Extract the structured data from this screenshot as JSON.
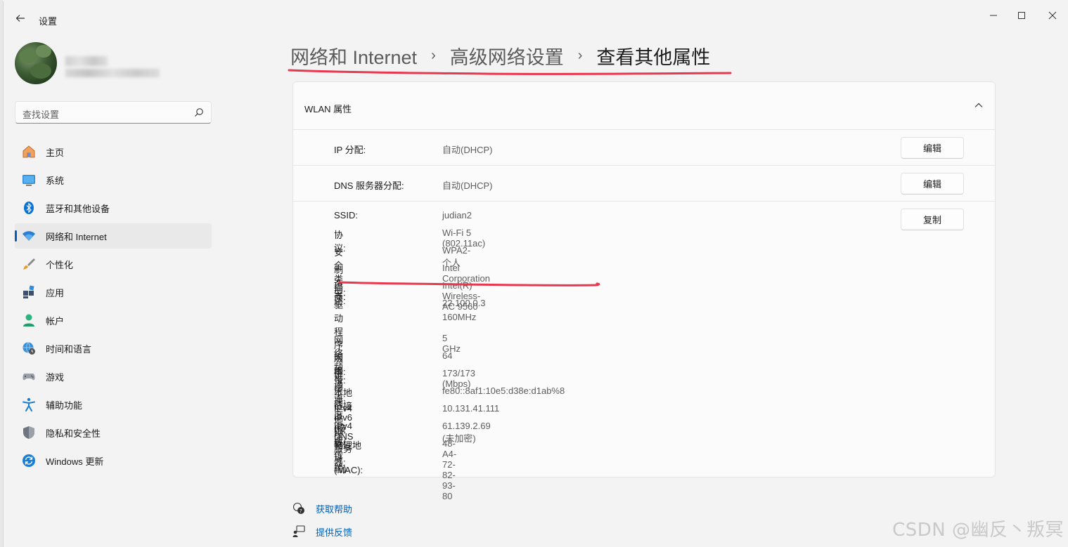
{
  "window": {
    "app_title": "设置",
    "controls": {
      "minimize": "—",
      "close": "✕"
    }
  },
  "search": {
    "placeholder": "查找设置"
  },
  "sidebar": {
    "items": [
      {
        "label": "主页",
        "icon": "home-icon"
      },
      {
        "label": "系统",
        "icon": "monitor-icon"
      },
      {
        "label": "蓝牙和其他设备",
        "icon": "bluetooth-icon"
      },
      {
        "label": "网络和 Internet",
        "icon": "wifi-icon",
        "active": true
      },
      {
        "label": "个性化",
        "icon": "brush-icon"
      },
      {
        "label": "应用",
        "icon": "apps-icon"
      },
      {
        "label": "帐户",
        "icon": "person-icon"
      },
      {
        "label": "时间和语言",
        "icon": "globe-clock-icon"
      },
      {
        "label": "游戏",
        "icon": "gamepad-icon"
      },
      {
        "label": "辅助功能",
        "icon": "accessibility-icon"
      },
      {
        "label": "隐私和安全性",
        "icon": "shield-icon"
      },
      {
        "label": "Windows 更新",
        "icon": "update-icon"
      }
    ]
  },
  "breadcrumb": {
    "items": [
      "网络和 Internet",
      "高级网络设置",
      "查看其他属性"
    ],
    "separator": "›"
  },
  "card": {
    "title": "WLAN 属性",
    "ip": {
      "label": "IP 分配:",
      "value": "自动(DHCP)",
      "button": "编辑"
    },
    "dns": {
      "label": "DNS 服务器分配:",
      "value": "自动(DHCP)",
      "button": "编辑"
    },
    "copy_button": "复制",
    "properties": [
      {
        "label": "SSID:",
        "value": "judian2"
      },
      {
        "label": "协议:",
        "value": "Wi-Fi 5 (802.11ac)"
      },
      {
        "label": "安全类型:",
        "value": "WPA2-个人"
      },
      {
        "label": "制造商:",
        "value": "Intel Corporation"
      },
      {
        "label": "描述:",
        "value": "Intel(R) Wireless-AC 9560 160MHz"
      },
      {
        "label": "驱动程序版本:",
        "value": "22.100.0.3"
      },
      {
        "label": "网络频带:",
        "value": "5 GHz"
      },
      {
        "label": "网络通道:",
        "value": "64"
      },
      {
        "label": "链接速度(接收/传输):",
        "value": "173/173 (Mbps)"
      },
      {
        "label": "本地链接 IPv6 地址:",
        "value": "fe80::8af1:10e5:d38e:d1ab%8"
      },
      {
        "label": "IPv4 地址:",
        "value": "10.131.41.111"
      },
      {
        "label": "IPv4 DNS 服务器:",
        "value": "61.139.2.69 (未加密)"
      },
      {
        "label": "物理地址(MAC):",
        "value": "48-A4-72-82-93-80"
      }
    ]
  },
  "footer": {
    "help": "获取帮助",
    "feedback": "提供反馈"
  },
  "watermark": "CSDN @幽反丶叛冥",
  "colors": {
    "accent": "#005fb8",
    "annotation_red": "#e8384f"
  }
}
